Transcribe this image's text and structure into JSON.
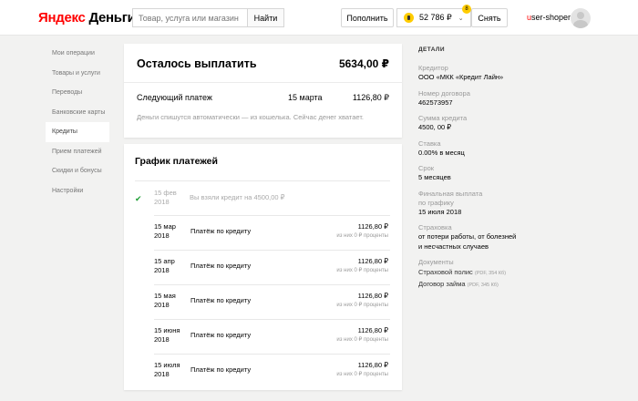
{
  "header": {
    "logo_brand": "Яндекс",
    "logo_product": "Деньги",
    "search_placeholder": "Товар, услуга или магазин",
    "search_button": "Найти",
    "topup_button": "Пополнить",
    "balance": "52 786 ₽",
    "notifications_count": "8",
    "withdraw_button": "Снять",
    "username_first": "u",
    "username_rest": "ser-shoper"
  },
  "sidebar": {
    "items": [
      {
        "label": "Мои операции"
      },
      {
        "label": "Товары и услуги"
      },
      {
        "label": "Переводы"
      },
      {
        "label": "Банковские карты"
      },
      {
        "label": "Кредиты"
      },
      {
        "label": "Прием платежей"
      },
      {
        "label": "Скидки и бонусы"
      },
      {
        "label": "Настройки"
      }
    ],
    "active_index": 4
  },
  "summary": {
    "title": "Осталось выплатить",
    "amount": "5634,00 ₽",
    "next_label": "Следующий платеж",
    "next_date": "15 марта",
    "next_amount": "1126,80 ₽",
    "note": "Деньги спишутся автоматически — из кошелька. Сейчас денег хватает."
  },
  "schedule": {
    "title": "График платежей",
    "first": {
      "date_line1": "15 фев",
      "date_line2": "2018",
      "desc": "Вы взяли кредит на 4500,00 ₽"
    },
    "payments": [
      {
        "date_line1": "15 мар",
        "date_line2": "2018",
        "desc": "Платёж по кредиту",
        "amount": "1126,80 ₽",
        "sub": "из них 0 ₽ проценты"
      },
      {
        "date_line1": "15 апр",
        "date_line2": "2018",
        "desc": "Платёж по кредиту",
        "amount": "1126,80 ₽",
        "sub": "из них 0 ₽ проценты"
      },
      {
        "date_line1": "15 мая",
        "date_line2": "2018",
        "desc": "Платёж по кредиту",
        "amount": "1126,80 ₽",
        "sub": "из них 0 ₽ проценты"
      },
      {
        "date_line1": "15 июня",
        "date_line2": "2018",
        "desc": "Платёж по кредиту",
        "amount": "1126,80 ₽",
        "sub": "из них 0 ₽ проценты"
      },
      {
        "date_line1": "15 июля",
        "date_line2": "2018",
        "desc": "Платёж по кредиту",
        "amount": "1126,80 ₽",
        "sub": "из них 0 ₽ проценты"
      }
    ]
  },
  "details": {
    "heading": "ДЕТАЛИ",
    "creditor_label": "Кредитор",
    "creditor_value": "ООО «МКК «Кредит Лайн»",
    "contract_label": "Номер договора",
    "contract_value": "462573957",
    "sum_label": "Сумма кредита",
    "sum_value": "4500, 00 ₽",
    "rate_label": "Ставка",
    "rate_value": "0.00% в месяц",
    "term_label": "Срок",
    "term_value": "5 месяцев",
    "final_label_1": "Финальная выплата",
    "final_label_2": "по графику",
    "final_value": "15 июля 2018",
    "insurance_label": "Страховка",
    "insurance_value_1": "от потери работы, от болезней",
    "insurance_value_2": "и несчастных случаев",
    "docs_label": "Документы",
    "doc1_name": "Страховой полис",
    "doc1_meta": "(PDF, 354 Кб)",
    "doc2_name": "Договор займа",
    "doc2_meta": "(PDF, 345 Кб)"
  }
}
